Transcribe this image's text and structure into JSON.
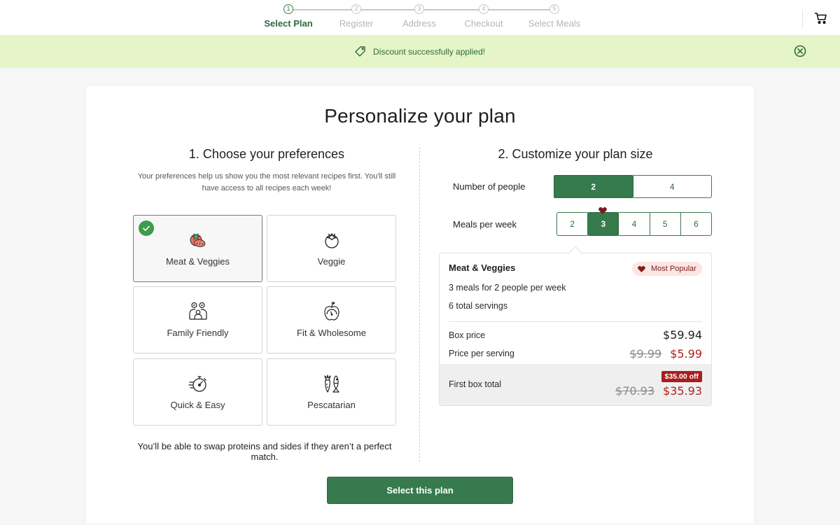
{
  "stepper": {
    "steps": [
      {
        "number": "1",
        "label": "Select Plan",
        "active": true
      },
      {
        "number": "2",
        "label": "Register",
        "active": false
      },
      {
        "number": "3",
        "label": "Address",
        "active": false
      },
      {
        "number": "4",
        "label": "Checkout",
        "active": false
      },
      {
        "number": "5",
        "label": "Select Meals",
        "active": false
      }
    ]
  },
  "header": {
    "cart_icon": "cart-icon"
  },
  "banner": {
    "icon": "tag-icon",
    "message": "Discount successfully applied!",
    "close_icon": "close-circle-icon"
  },
  "page": {
    "title": "Personalize your plan"
  },
  "preferences": {
    "title": "1. Choose your preferences",
    "description": "Your preferences help us show you the most relevant recipes first. You'll still have access to all recipes each week!",
    "options": [
      {
        "label": "Meat & Veggies",
        "icon": "meat-veggies-icon",
        "selected": true
      },
      {
        "label": "Veggie",
        "icon": "tomato-icon",
        "selected": false
      },
      {
        "label": "Family Friendly",
        "icon": "family-icon",
        "selected": false
      },
      {
        "label": "Fit & Wholesome",
        "icon": "apple-scale-icon",
        "selected": false
      },
      {
        "label": "Quick & Easy",
        "icon": "stopwatch-icon",
        "selected": false
      },
      {
        "label": "Pescatarian",
        "icon": "carrot-fish-icon",
        "selected": false
      }
    ],
    "swap_note": "You’ll be able to swap proteins and sides if they aren’t a perfect match."
  },
  "plan_size": {
    "title": "2. Customize your plan size",
    "people": {
      "label": "Number of people",
      "options": [
        "2",
        "4"
      ],
      "selected": "2"
    },
    "meals": {
      "label": "Meals per week",
      "options": [
        "2",
        "3",
        "4",
        "5",
        "6"
      ],
      "selected": "3",
      "popular": "3"
    }
  },
  "summary": {
    "plan_name": "Meat & Veggies",
    "badge": "Most Popular",
    "description": "3 meals for 2 people per week",
    "servings": "6 total servings",
    "box_price_label": "Box price",
    "box_price": "$59.94",
    "per_serving_label": "Price per serving",
    "per_serving_original": "$9.99",
    "per_serving_discounted": "$5.99",
    "first_box_label": "First box total",
    "discount_badge": "$35.00 off",
    "first_box_original": "$70.93",
    "first_box_discounted": "$35.93"
  },
  "cta": {
    "label": "Select this plan"
  },
  "colors": {
    "brand_green": "#367a4e",
    "banner_bg": "#e5f5c7",
    "discount_red": "#b51f1f",
    "popular_badge_bg": "#fbe6e4"
  }
}
